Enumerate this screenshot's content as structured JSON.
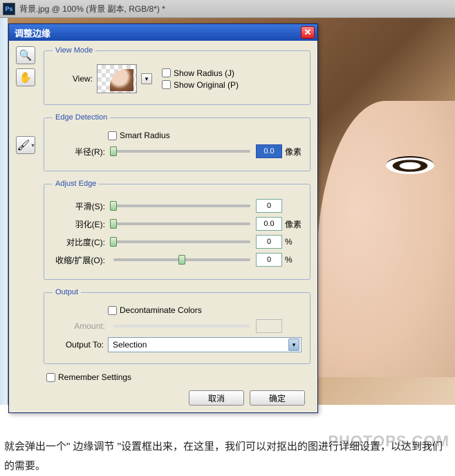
{
  "ps_bar": {
    "icon": "Ps",
    "title": "背景.jpg @ 100% (背景 副本, RGB/8*) *"
  },
  "dialog": {
    "title": "调整边缘",
    "view_mode": {
      "legend": "View Mode",
      "view_label": "View:",
      "show_radius": "Show Radius (J)",
      "show_original": "Show Original (P)"
    },
    "edge_detection": {
      "legend": "Edge Detection",
      "smart_radius": "Smart Radius",
      "radius_label": "半径(R):",
      "radius_value": "0.0",
      "radius_unit": "像素"
    },
    "adjust_edge": {
      "legend": "Adjust Edge",
      "smooth_label": "平滑(S):",
      "smooth_value": "0",
      "feather_label": "羽化(E):",
      "feather_value": "0.0",
      "feather_unit": "像素",
      "contrast_label": "对比度(C):",
      "contrast_value": "0",
      "contrast_unit": "%",
      "shift_label": "收缩/扩展(O):",
      "shift_value": "0",
      "shift_unit": "%"
    },
    "output": {
      "legend": "Output",
      "decontaminate": "Decontaminate Colors",
      "amount_label": "Amount:",
      "amount_value": "",
      "output_to_label": "Output To:",
      "output_to_value": "Selection"
    },
    "remember": "Remember Settings",
    "cancel": "取消",
    "ok": "确定"
  },
  "caption": "就会弹出一个\" 边缘调节 \"设置框出来，在这里，我们可以对抠出的图进行详细设置，以达到我们的需要。",
  "watermark": "PHOTOPS.COM"
}
